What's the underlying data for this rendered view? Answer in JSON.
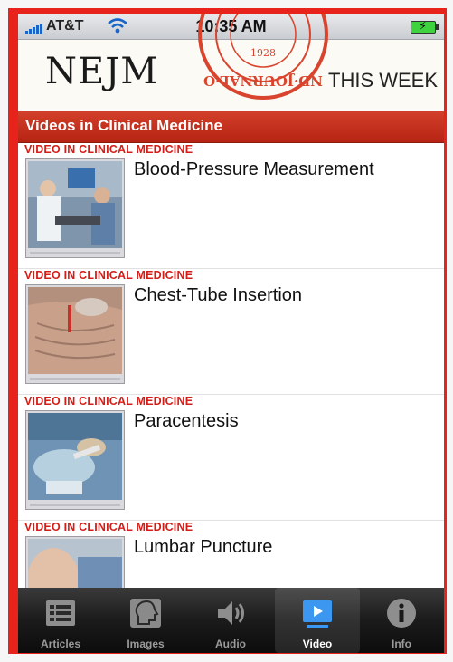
{
  "status_bar": {
    "carrier": "AT&T",
    "time": "10:35 AM"
  },
  "masthead": {
    "logo": "NEJM",
    "seal_year": "1928",
    "seal_text": "ND·JOURNAL·O",
    "this_week": "THIS WEEK"
  },
  "section": {
    "title": "Videos in Clinical Medicine"
  },
  "videos": [
    {
      "kicker": "VIDEO IN CLINICAL MEDICINE",
      "title": "Blood-Pressure Measurement"
    },
    {
      "kicker": "VIDEO IN CLINICAL MEDICINE",
      "title": "Chest-Tube Insertion"
    },
    {
      "kicker": "VIDEO IN CLINICAL MEDICINE",
      "title": "Paracentesis"
    },
    {
      "kicker": "VIDEO IN CLINICAL MEDICINE",
      "title": "Lumbar Puncture"
    }
  ],
  "tabs": [
    {
      "label": "Articles",
      "icon": "list-icon"
    },
    {
      "label": "Images",
      "icon": "head-profile-icon"
    },
    {
      "label": "Audio",
      "icon": "speaker-icon"
    },
    {
      "label": "Video",
      "icon": "play-video-icon",
      "active": true
    },
    {
      "label": "Info",
      "icon": "info-icon"
    }
  ],
  "colors": {
    "accent_red": "#d51c17",
    "header_red": "#c23220",
    "active_tab_blue": "#3b97f0"
  }
}
